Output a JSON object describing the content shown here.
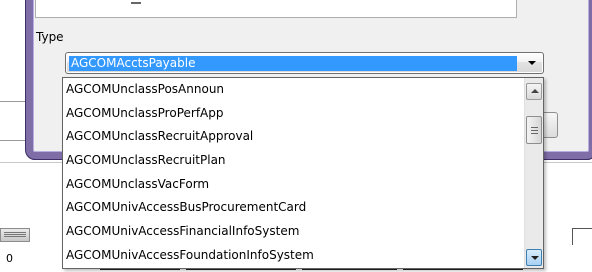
{
  "dialog": {
    "type_label": "Type"
  },
  "combo": {
    "selected_value": "AGCOMAcctsPayable"
  },
  "dropdown": {
    "items": [
      "AGCOMUnclassPosAnnoun",
      "AGCOMUnclassProPerfApp",
      "AGCOMUnclassRecruitApproval",
      "AGCOMUnclassRecruitPlan",
      "AGCOMUnclassVacForm",
      "AGCOMUnivAccessBusProcurementCard",
      "AGCOMUnivAccessFinancialInfoSystem",
      "AGCOMUnivAccessFoundationInfoSystem"
    ]
  },
  "background": {
    "zero_text": "0"
  },
  "icons": {
    "dropdown_arrow": "chevron-down-icon",
    "scroll_up": "scroll-up-icon",
    "scroll_down": "scroll-down-icon"
  },
  "colors": {
    "selection": "#3399ff",
    "window_frame": "#7f6da8"
  }
}
